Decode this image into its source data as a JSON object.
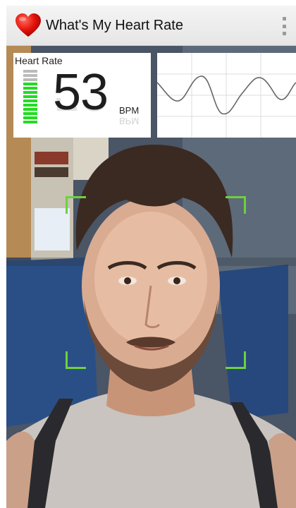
{
  "app": {
    "title": "What's My Heart Rate",
    "icon": "heart-icon",
    "menu_icon": "overflow-menu-icon"
  },
  "heart_rate": {
    "label": "Heart Rate",
    "value": "53",
    "unit": "BPM",
    "signal_level": 0.8,
    "meter_segments": 13,
    "meter_active_color": "#22dd22",
    "meter_inactive_color": "#bbbbbb"
  },
  "waveform": {
    "grid": true
  },
  "camera": {
    "face_frame_color": "#6ed13b"
  }
}
